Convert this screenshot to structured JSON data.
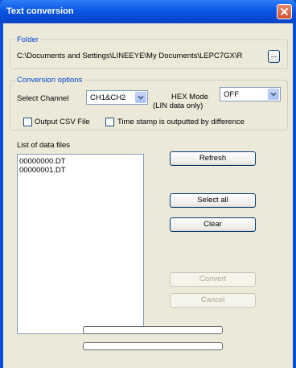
{
  "window": {
    "title": "Text conversion"
  },
  "folder": {
    "legend": "Folder",
    "path": "C:\\Documents and Settings\\LINEEYE\\My Documents\\LEPC7GX\\R",
    "browse_label": "..."
  },
  "conversion": {
    "legend": "Conversion options",
    "channel_label": "Select Channel",
    "channel_value": "CH1&CH2",
    "hex_label": "HEX Mode",
    "hex_note": "(LIN data only)",
    "hex_value": "OFF",
    "csv_label": "Output CSV File",
    "csv_checked": false,
    "timestamp_label": "Time stamp is outputted by difference",
    "timestamp_checked": false
  },
  "files": {
    "label": "List of data files",
    "items": [
      "00000000.DT",
      "00000001.DT"
    ]
  },
  "buttons": {
    "refresh": "Refresh",
    "select_all": "Select all",
    "clear": "Clear",
    "convert": "Convert",
    "cancel": "Cancel"
  },
  "progress": {
    "bar1": 0,
    "bar2": 0
  },
  "colors": {
    "title_bar": "#0a58e5",
    "legend": "#0046d5",
    "client": "#ece9d8"
  }
}
